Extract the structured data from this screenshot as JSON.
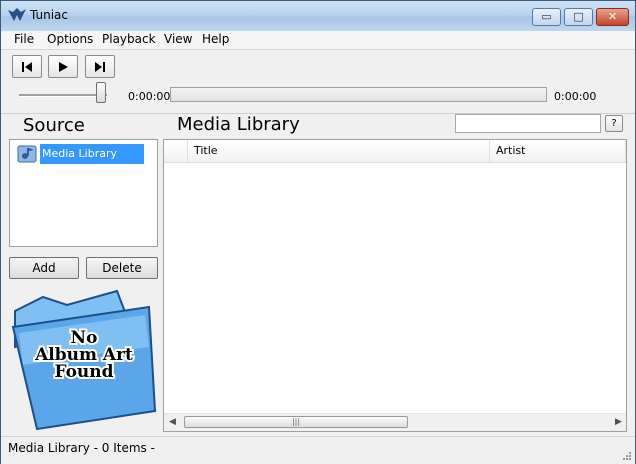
{
  "window": {
    "title": "Tuniac"
  },
  "caption_buttons": {
    "minimize": "▭",
    "maximize": "□",
    "close": "✕"
  },
  "menu": [
    {
      "label": "File"
    },
    {
      "label": "Options"
    },
    {
      "label": "Playback"
    },
    {
      "label": "View"
    },
    {
      "label": "Help"
    }
  ],
  "transport": {
    "previous_icon": "skip-previous-icon",
    "play_icon": "play-icon",
    "next_icon": "skip-next-icon",
    "elapsed": "0:00:00",
    "remaining": "0:00:00"
  },
  "source": {
    "header": "Source",
    "items": [
      {
        "label": "Media Library",
        "icon": "media-library-icon",
        "selected": true
      }
    ],
    "add_label": "Add",
    "delete_label": "Delete"
  },
  "album_art": {
    "text_lines": [
      "No",
      "Album Art",
      "Found"
    ],
    "icon": "folder-icon"
  },
  "library": {
    "header": "Media Library",
    "search_value": "",
    "help_label": "?",
    "columns": [
      {
        "label": "Title"
      },
      {
        "label": "Artist"
      }
    ],
    "scroll_grip": "|||"
  },
  "status": {
    "text": "Media Library - 0 Items -"
  },
  "colors": {
    "selection": "#3399ff",
    "titlebar": "#b9d3ee",
    "folder": "#4a9de0"
  }
}
